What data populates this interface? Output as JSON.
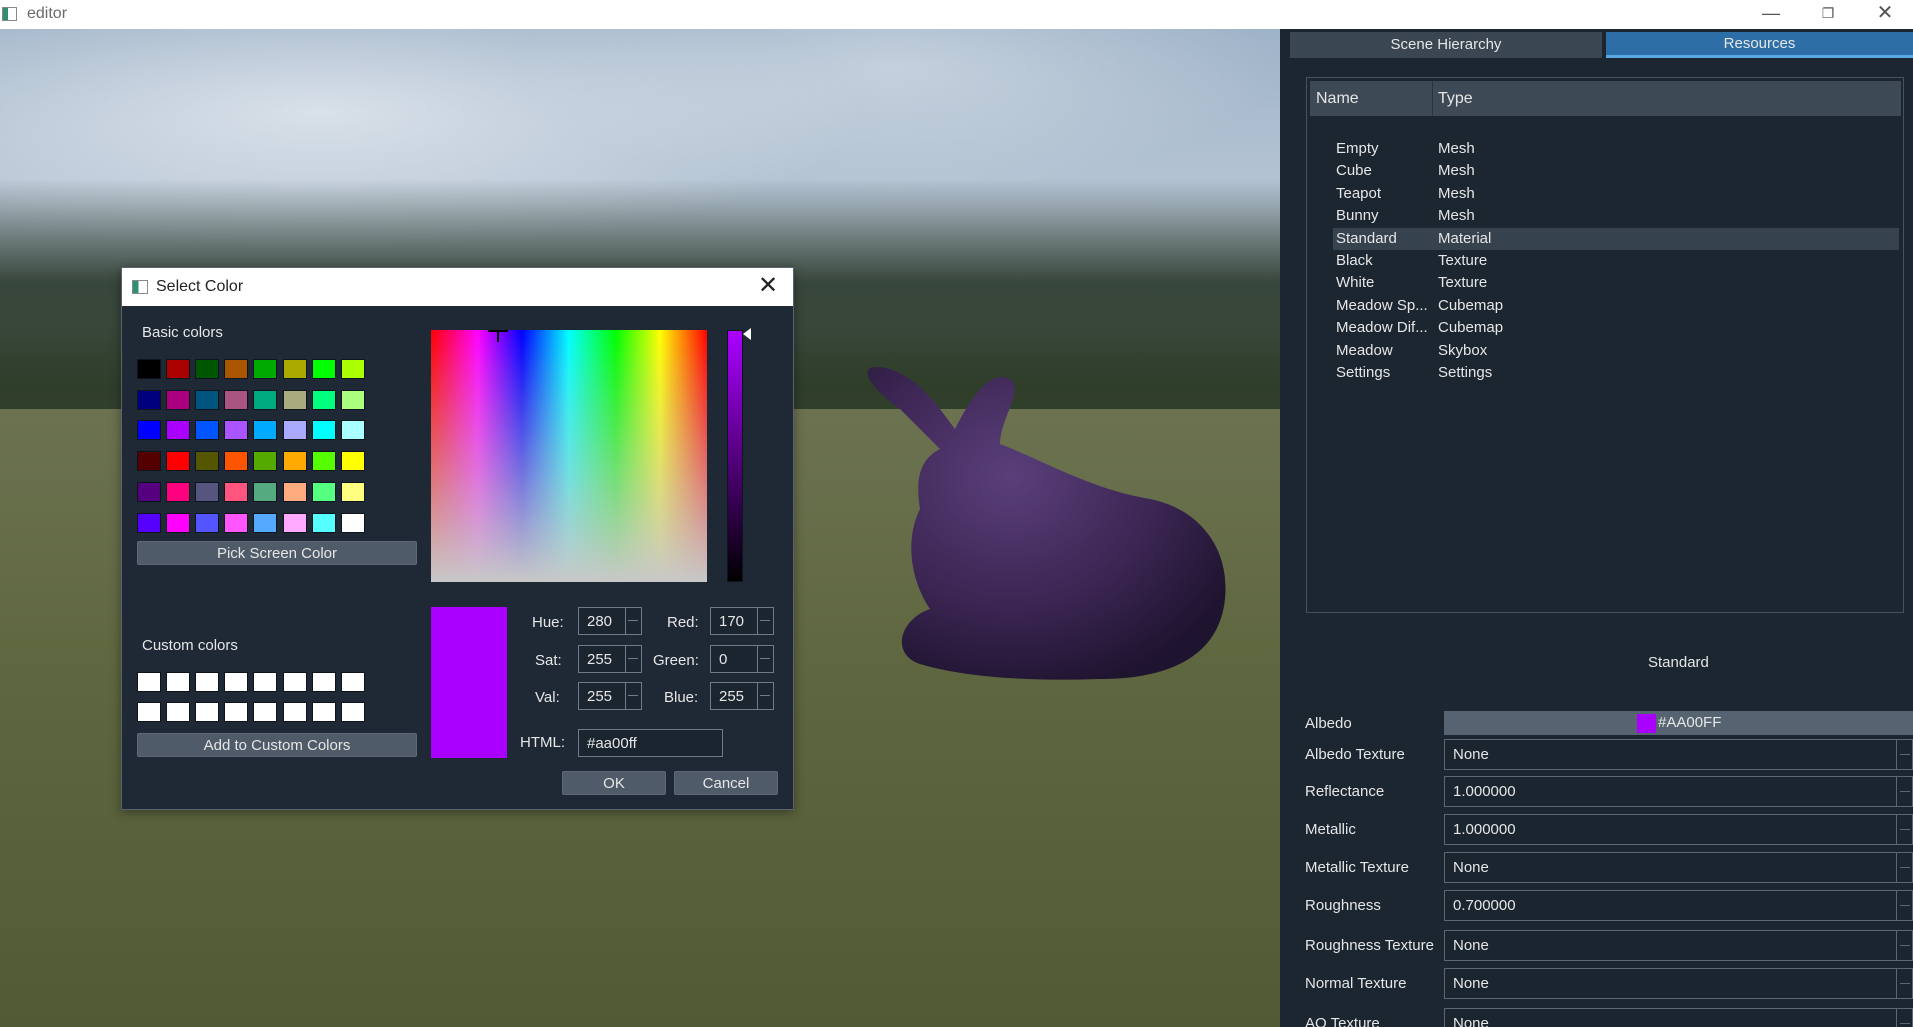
{
  "window": {
    "title": "editor"
  },
  "dialog": {
    "title": "Select Color",
    "basic_colors_label": "Basic colors",
    "basic_colors": [
      [
        "#000000",
        "#aa0000",
        "#005500",
        "#aa5500",
        "#00aa00",
        "#aaaa00",
        "#00ff00",
        "#aaff00"
      ],
      [
        "#00007f",
        "#aa007f",
        "#00557f",
        "#aa557f",
        "#00aa7f",
        "#aaaa7f",
        "#00ff7f",
        "#aaff7f"
      ],
      [
        "#0000ff",
        "#aa00ff",
        "#0055ff",
        "#aa55ff",
        "#00aaff",
        "#aaaaff",
        "#00ffff",
        "#aaffff"
      ],
      [
        "#550000",
        "#ff0000",
        "#555500",
        "#ff5500",
        "#55aa00",
        "#ffaa00",
        "#55ff00",
        "#ffff00"
      ],
      [
        "#55007f",
        "#ff007f",
        "#55557f",
        "#ff557f",
        "#55aa7f",
        "#ffaa7f",
        "#55ff7f",
        "#ffff7f"
      ],
      [
        "#5500ff",
        "#ff00ff",
        "#5555ff",
        "#ff55ff",
        "#55aaff",
        "#ffaaff",
        "#55ffff",
        "#ffffff"
      ]
    ],
    "pick_screen_color": "Pick Screen Color",
    "custom_colors_label": "Custom colors",
    "custom_colors": [
      [
        "#ffffff",
        "#ffffff",
        "#ffffff",
        "#ffffff",
        "#ffffff",
        "#ffffff",
        "#ffffff",
        "#ffffff"
      ],
      [
        "#ffffff",
        "#ffffff",
        "#ffffff",
        "#ffffff",
        "#ffffff",
        "#ffffff",
        "#ffffff",
        "#ffffff"
      ]
    ],
    "add_custom": "Add to Custom Colors",
    "current_color": "#aa00ff",
    "hue_label": "Hue:",
    "hue": "280",
    "sat_label": "Sat:",
    "sat": "255",
    "val_label": "Val:",
    "val": "255",
    "red_label": "Red:",
    "red": "170",
    "green_label": "Green:",
    "green": "0",
    "blue_label": "Blue:",
    "blue": "255",
    "html_label": "HTML:",
    "html": "#aa00ff",
    "ok": "OK",
    "cancel": "Cancel"
  },
  "panel": {
    "tabs": [
      "Scene Hierarchy",
      "Resources"
    ],
    "active_tab": "Resources",
    "columns": [
      "Name",
      "Type"
    ],
    "rows": [
      {
        "name": "Empty",
        "type": "Mesh"
      },
      {
        "name": "Cube",
        "type": "Mesh"
      },
      {
        "name": "Teapot",
        "type": "Mesh"
      },
      {
        "name": "Bunny",
        "type": "Mesh"
      },
      {
        "name": "Standard",
        "type": "Material"
      },
      {
        "name": "Black",
        "type": "Texture"
      },
      {
        "name": "White",
        "type": "Texture"
      },
      {
        "name": "Meadow Sp...",
        "type": "Cubemap"
      },
      {
        "name": "Meadow Dif...",
        "type": "Cubemap"
      },
      {
        "name": "Meadow",
        "type": "Skybox"
      },
      {
        "name": "Settings",
        "type": "Settings"
      }
    ],
    "selected_row": "Standard",
    "properties_title": "Standard",
    "albedo_label": "Albedo",
    "albedo_value": "#AA00FF",
    "albedo_color": "#aa00ff",
    "properties": [
      {
        "label": "Albedo Texture",
        "value": "None",
        "kind": "combo"
      },
      {
        "label": "Reflectance",
        "value": "1.000000",
        "kind": "spin"
      },
      {
        "label": "Metallic",
        "value": "1.000000",
        "kind": "spin"
      },
      {
        "label": "Metallic Texture",
        "value": "None",
        "kind": "combo"
      },
      {
        "label": "Roughness",
        "value": "0.700000",
        "kind": "spin"
      },
      {
        "label": "Roughness Texture",
        "value": "None",
        "kind": "combo"
      },
      {
        "label": "Normal Texture",
        "value": "None",
        "kind": "combo"
      },
      {
        "label": "AO Texture",
        "value": "None",
        "kind": "combo"
      }
    ]
  }
}
